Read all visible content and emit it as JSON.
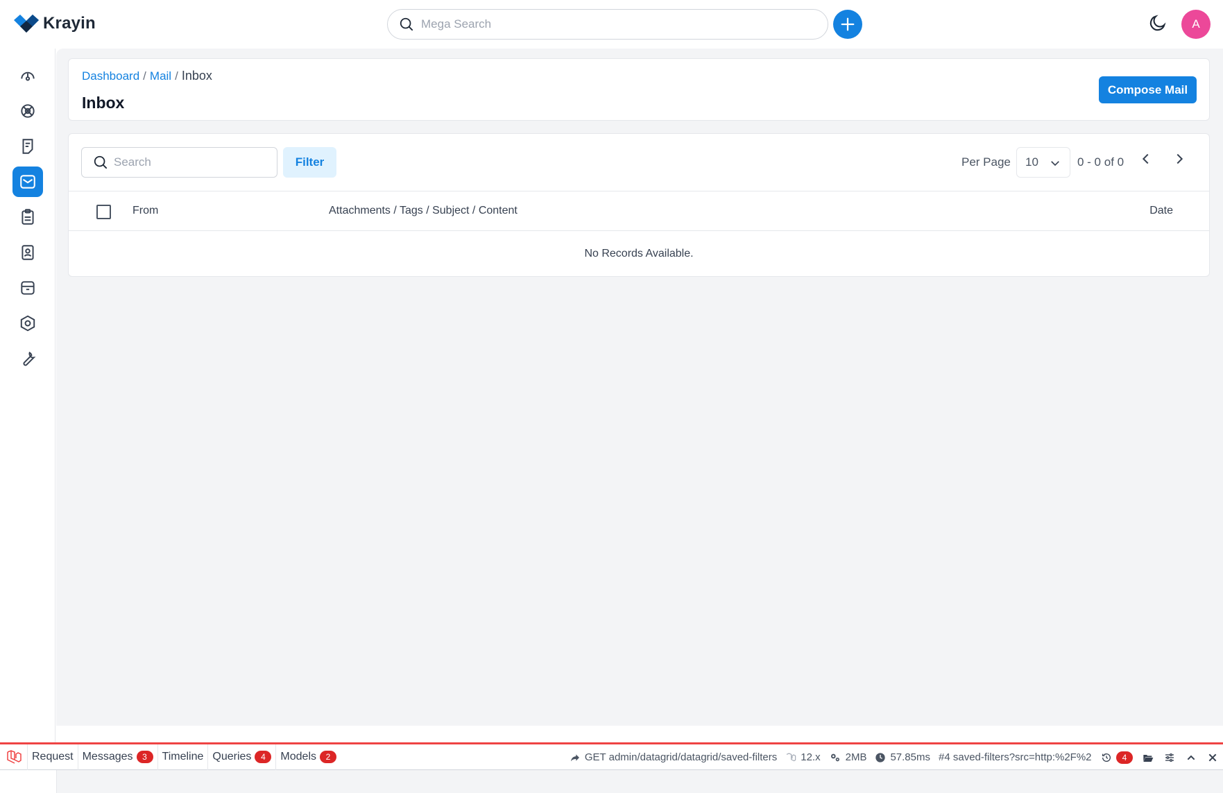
{
  "app": {
    "brand": "Krayin",
    "search_placeholder": "Mega Search",
    "avatar_initial": "A",
    "accent_color": "#1482e0"
  },
  "sidebar": {
    "items": [
      {
        "icon": "dashboard-gauge-icon",
        "active": false
      },
      {
        "icon": "leads-icon",
        "active": false
      },
      {
        "icon": "quotes-icon",
        "active": false
      },
      {
        "icon": "mail-icon",
        "active": true
      },
      {
        "icon": "activities-icon",
        "active": false
      },
      {
        "icon": "contacts-icon",
        "active": false
      },
      {
        "icon": "products-icon",
        "active": false
      },
      {
        "icon": "settings-icon",
        "active": false
      },
      {
        "icon": "configuration-wrench-icon",
        "active": false
      }
    ]
  },
  "page": {
    "breadcrumb": [
      {
        "label": "Dashboard"
      },
      {
        "label": "Mail"
      },
      {
        "label": "Inbox"
      }
    ],
    "separator": "/",
    "title": "Inbox",
    "compose_label": "Compose Mail"
  },
  "datagrid": {
    "search_placeholder": "Search",
    "filter_label": "Filter",
    "per_page_label": "Per Page",
    "per_page_value": "10",
    "range_text": "0 - 0 of 0",
    "columns": [
      "From",
      "Attachments / Tags / Subject / Content",
      "Date"
    ],
    "empty_text": "No Records Available."
  },
  "debugbar": {
    "tabs": [
      {
        "label": "Request",
        "badge": null
      },
      {
        "label": "Messages",
        "badge": "3"
      },
      {
        "label": "Timeline",
        "badge": null
      },
      {
        "label": "Queries",
        "badge": "4"
      },
      {
        "label": "Models",
        "badge": "2"
      }
    ],
    "request_route": "GET admin/datagrid/datagrid/saved-filters",
    "laravel_version": "12.x",
    "memory": "2MB",
    "duration": "57.85ms",
    "request_hash": "#4 saved-filters?src=http:%2F%2",
    "history_badge": "4"
  }
}
